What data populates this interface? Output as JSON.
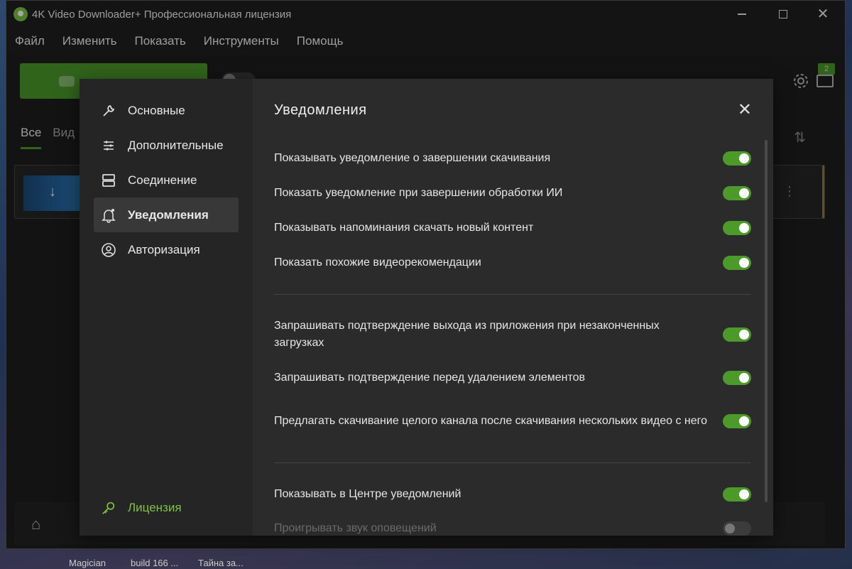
{
  "window": {
    "title": "4K Video Downloader+ Профессиональная лицензия"
  },
  "menu": [
    "Файл",
    "Изменить",
    "Показать",
    "Инструменты",
    "Помощь"
  ],
  "toolbar": {
    "queue_count": "2"
  },
  "tabs": [
    "Все",
    "Вид"
  ],
  "settings_dialog": {
    "title": "Уведомления",
    "nav": [
      {
        "label": "Основные",
        "icon": "wrench-icon",
        "active": false
      },
      {
        "label": "Дополнительные",
        "icon": "sliders-icon",
        "active": false
      },
      {
        "label": "Соединение",
        "icon": "server-icon",
        "active": false
      },
      {
        "label": "Уведомления",
        "icon": "bell-icon",
        "active": true
      },
      {
        "label": "Авторизация",
        "icon": "user-circle-icon",
        "active": false
      }
    ],
    "license_label": "Лицензия",
    "groups": [
      [
        {
          "label": "Показывать уведомление о завершении скачивания",
          "enabled": true
        },
        {
          "label": "Показать уведомление при завершении обработки ИИ",
          "enabled": true
        },
        {
          "label": "Показывать напоминания скачать новый контент",
          "enabled": true
        },
        {
          "label": "Показать похожие видеорекомендации",
          "enabled": true
        }
      ],
      [
        {
          "label": "Запрашивать подтверждение выхода из приложения при незаконченных загрузках",
          "enabled": true
        },
        {
          "label": "Запрашивать подтверждение перед удалением элементов",
          "enabled": true
        },
        {
          "label": "Предлагать скачивание целого канала после скачивания нескольких видео с него",
          "enabled": true
        }
      ],
      [
        {
          "label": "Показывать в Центре уведомлений",
          "enabled": true
        },
        {
          "label": "Проигрывать звук оповещений",
          "enabled": false
        }
      ]
    ]
  },
  "taskbar": [
    "Magician",
    "build 166 ...",
    "Тайна за..."
  ],
  "colors": {
    "accent": "#4c9a2a",
    "license_text": "#7cc344",
    "dialog_bg": "#2b2b2b",
    "sidebar_bg": "#252525"
  }
}
